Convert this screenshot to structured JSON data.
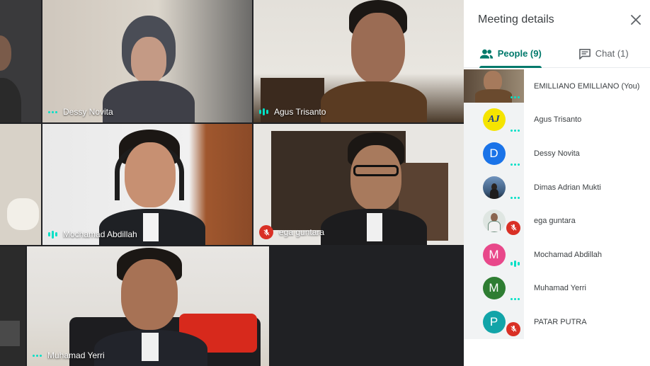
{
  "tiles": [
    {
      "name": "Dessy Novita",
      "status": "speaking-dots"
    },
    {
      "name": "Agus Trisanto",
      "status": "speaking-bars"
    },
    {
      "name": "Mochamad Abdillah",
      "status": "speaking-bars"
    },
    {
      "name": "ega guntara",
      "status": "muted"
    },
    {
      "name": "Muhamad Yerri",
      "status": "speaking-dots"
    }
  ],
  "panel": {
    "title": "Meeting details",
    "tabs": [
      {
        "label": "People (9)",
        "icon": "people-icon",
        "active": true
      },
      {
        "label": "Chat (1)",
        "icon": "chat-icon",
        "active": false
      }
    ],
    "people": [
      {
        "name": "EMILLIANO EMILLIANO (You)",
        "avatar": "photo-wide",
        "status": "speaking-dots"
      },
      {
        "name": "Agus Trisanto",
        "avatar": "logo",
        "initial": "AJ",
        "color": "#f5e400",
        "status": "speaking-dots"
      },
      {
        "name": "Dessy Novita",
        "avatar": "letter",
        "initial": "D",
        "color": "#1a73e8",
        "status": "speaking-dots"
      },
      {
        "name": "Dimas Adrian Mukti",
        "avatar": "photo",
        "color": "#5b7fa6",
        "status": "speaking-dots"
      },
      {
        "name": "ega guntara",
        "avatar": "photo",
        "color": "#9aa6a0",
        "status": "muted"
      },
      {
        "name": "Mochamad Abdillah",
        "avatar": "letter",
        "initial": "M",
        "color": "#e8488a",
        "status": "speaking-bars"
      },
      {
        "name": "Muhamad Yerri",
        "avatar": "letter",
        "initial": "M",
        "color": "#2e7d32",
        "status": "speaking-dots"
      },
      {
        "name": "PATAR PUTRA",
        "avatar": "letter",
        "initial": "P",
        "color": "#12a4a8",
        "status": "muted"
      }
    ]
  },
  "colors": {
    "accent": "#00796b",
    "speaking": "#00e0c6",
    "muted": "#d93025"
  }
}
